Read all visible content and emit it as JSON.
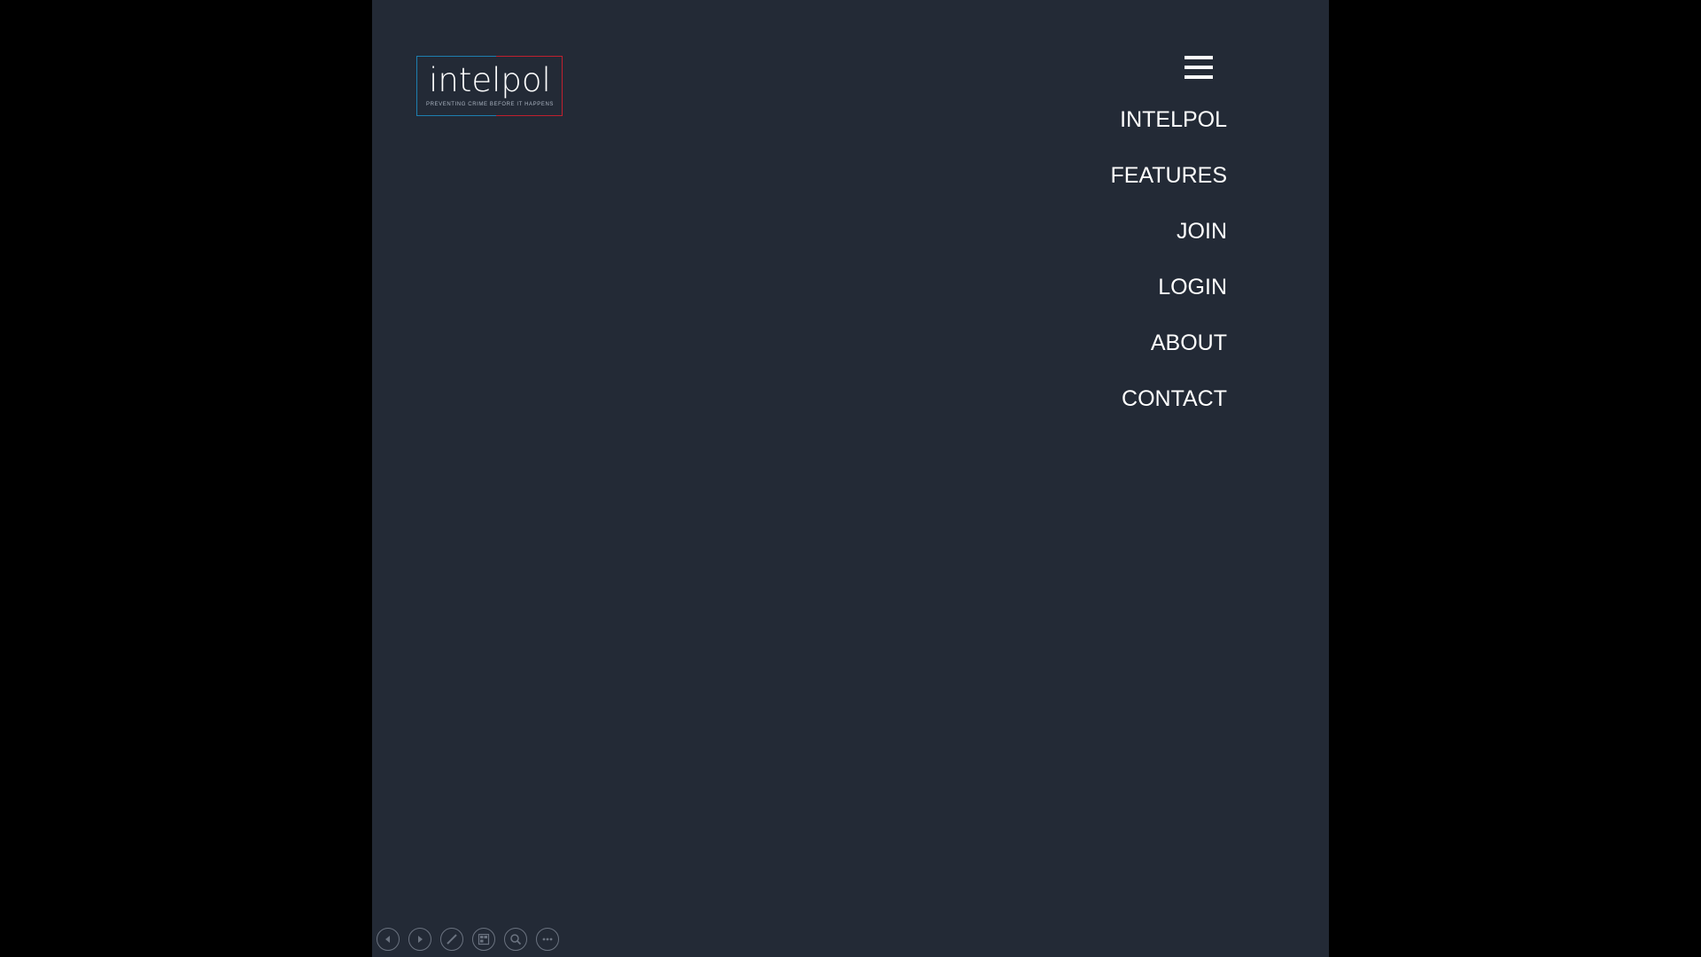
{
  "logo": {
    "wordmark": "intelpol",
    "tagline": "PREVENTING CRIME BEFORE IT HAPPENS",
    "colors": {
      "left": "#1d7fb0",
      "right": "#c0202e"
    }
  },
  "menu": {
    "toggle_icon": "hamburger-menu-icon",
    "items": [
      {
        "label": "INTELPOL"
      },
      {
        "label": "FEATURES"
      },
      {
        "label": "JOIN"
      },
      {
        "label": "LOGIN"
      },
      {
        "label": "ABOUT"
      },
      {
        "label": "CONTACT"
      }
    ]
  },
  "slideshow_controls": {
    "buttons": [
      {
        "icon": "previous-icon"
      },
      {
        "icon": "next-icon"
      },
      {
        "icon": "pen-icon"
      },
      {
        "icon": "slides-grid-icon"
      },
      {
        "icon": "zoom-icon"
      },
      {
        "icon": "more-options-icon"
      }
    ]
  },
  "colors": {
    "slide_background": "#232a36",
    "letterbox": "#000000",
    "text": "#ffffff",
    "control_outline": "#6b7380"
  }
}
